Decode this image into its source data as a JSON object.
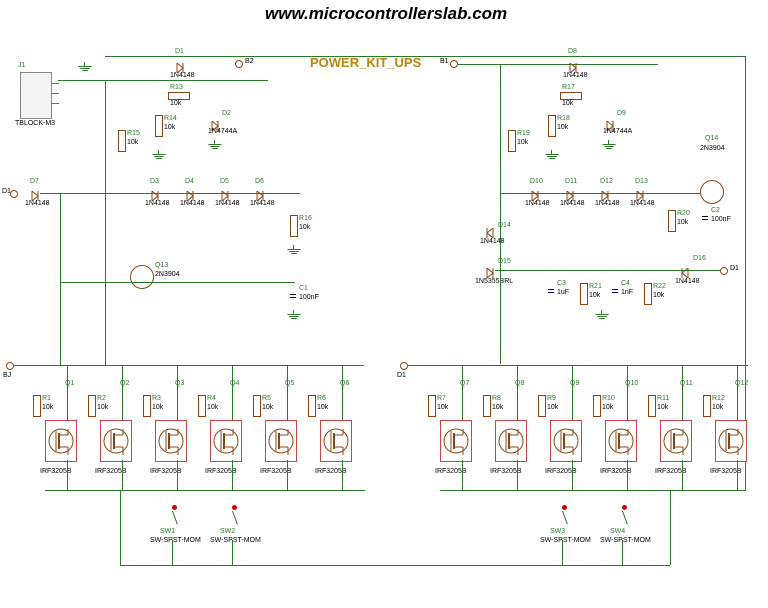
{
  "website": "www.microcontrollerslab.com",
  "title": "POWER_KIT_UPS",
  "connector": {
    "ref": "J1",
    "type": "TBLOCK-M3"
  },
  "left": {
    "diodes": {
      "D1": "1N4148",
      "D2": "1N4744A",
      "D3": "1N4148",
      "D4": "1N4148",
      "D5": "1N4148",
      "D6": "1N4148",
      "D7": "1N4148"
    },
    "resistors": {
      "R1": "10k",
      "R2": "10k",
      "R3": "10k",
      "R4": "10k",
      "R5": "10k",
      "R6": "10k",
      "R13": "10k",
      "R14": "10k",
      "R15": "10k",
      "R16": "10k"
    },
    "caps": {
      "C1": "100nF"
    },
    "transistors": {
      "Q13": "2N3904"
    },
    "mosfets": {
      "Q1": "IRF3205B",
      "Q2": "IRF3205B",
      "Q3": "IRF3205B",
      "Q4": "IRF3205B",
      "Q5": "IRF3205B",
      "Q6": "IRF3205B"
    },
    "switches": {
      "SW1": "SW-SPST-MOM",
      "SW2": "SW-SPST-MOM"
    }
  },
  "right": {
    "diodes": {
      "D8": "1N4148",
      "D9": "1N4744A",
      "D10": "1N4148",
      "D11": "1N4148",
      "D12": "1N4148",
      "D13": "1N4148",
      "D14": "1N4148",
      "D15": "1N5355BRL",
      "D16": "1N4148"
    },
    "resistors": {
      "R7": "10k",
      "R8": "10k",
      "R9": "10k",
      "R10": "10k",
      "R11": "10k",
      "R12": "10k",
      "R17": "10k",
      "R18": "10k",
      "R19": "10k",
      "R20": "10k",
      "R21": "10k",
      "R22": "10k"
    },
    "caps": {
      "C2": "100nF",
      "C3": "1uF",
      "C4": "1nF"
    },
    "transistors": {
      "Q14": "2N3904"
    },
    "mosfets": {
      "Q7": "IRF3205B",
      "Q8": "IRF3205B",
      "Q9": "IRF3205B",
      "Q10": "IRF3205B",
      "Q11": "IRF3205B",
      "Q12": "IRF3205B"
    },
    "switches": {
      "SW3": "SW-SPST-MOM",
      "SW4": "SW-SPST-MOM"
    }
  },
  "ports": {
    "B1l": "B1",
    "B2": "B2",
    "D1a": "D1",
    "B1r": "B1",
    "D1b": "D1",
    "D1c": "D1",
    "BJ": "BJ"
  }
}
